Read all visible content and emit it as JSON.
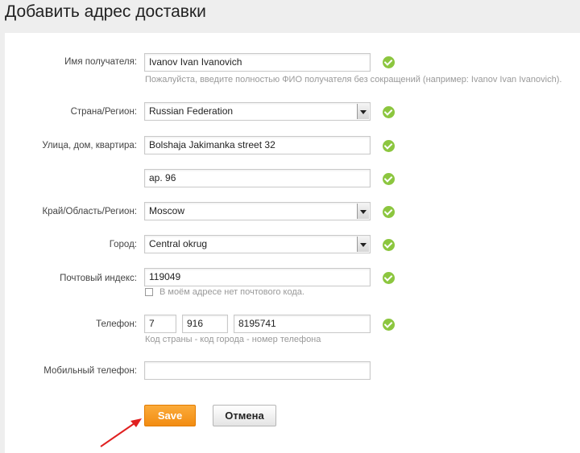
{
  "page": {
    "title": "Добавить адрес доставки"
  },
  "form": {
    "recipient": {
      "label": "Имя получателя:",
      "value": "Ivanov Ivan Ivanovich",
      "hint": "Пожалуйста, введите полностью ФИО получателя без сокращений (например: Ivanov Ivan Ivanovich)."
    },
    "country": {
      "label": "Страна/Регион:",
      "value": "Russian Federation"
    },
    "street": {
      "label": "Улица, дом, квартира:",
      "value": "Bolshaja Jakimanka street 32"
    },
    "apartment": {
      "value": "ap. 96"
    },
    "region": {
      "label": "Край/Область/Регион:",
      "value": "Moscow"
    },
    "city": {
      "label": "Город:",
      "value": "Central okrug"
    },
    "postal": {
      "label": "Почтовый индекс:",
      "value": "119049",
      "no_code_label": "В моём адресе нет почтового кода."
    },
    "phone": {
      "label": "Телефон:",
      "country_code": "7",
      "city_code": "916",
      "number": "8195741",
      "hint": "Код страны - код города - номер телефона"
    },
    "mobile": {
      "label": "Мобильный телефон:",
      "value": ""
    }
  },
  "buttons": {
    "save": "Save",
    "cancel": "Отмена"
  },
  "colors": {
    "accent": "#f28c12",
    "valid": "#8cc63f",
    "annotation_arrow": "#e02020"
  }
}
